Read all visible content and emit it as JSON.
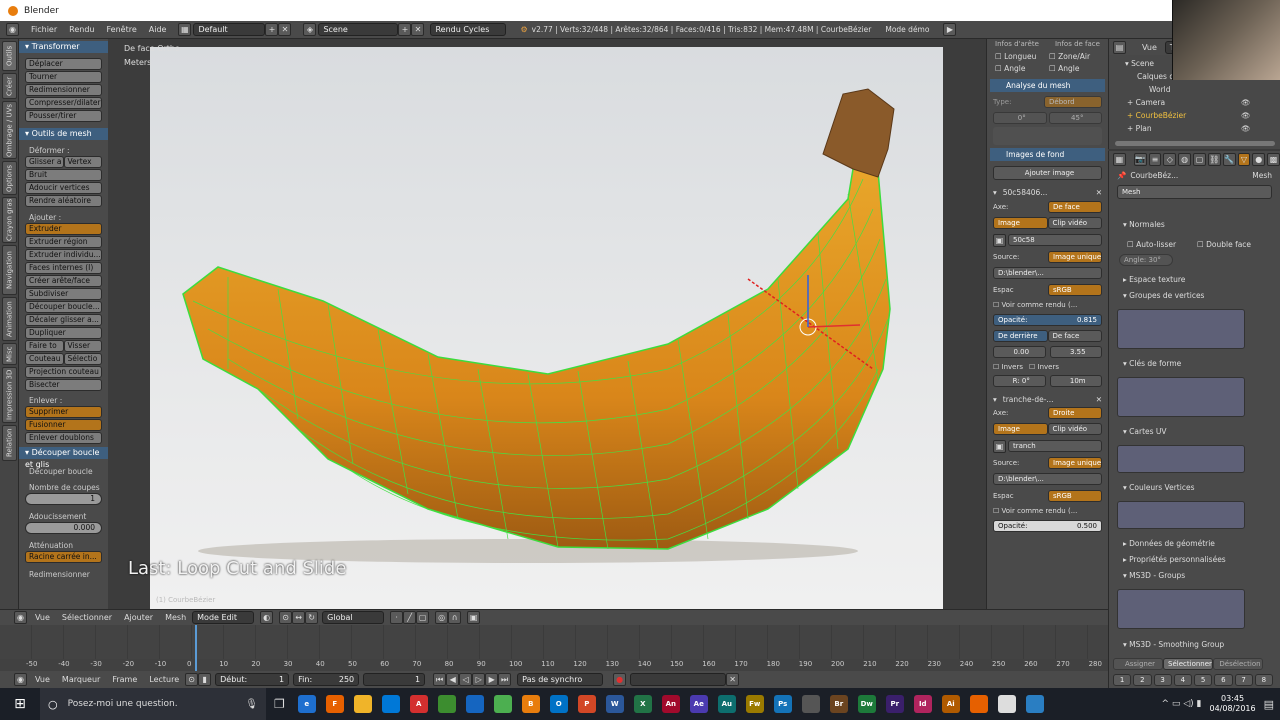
{
  "window": {
    "title": "Blender"
  },
  "menu": {
    "items": [
      "Fichier",
      "Rendu",
      "Fenêtre",
      "Aide"
    ],
    "layout": "Default",
    "scene": "Scene",
    "engine": "Rendu Cycles",
    "stats": "v2.77 | Verts:32/448 | Arêtes:32/864 | Faces:0/416 | Tris:832 | Mem:47.48M | CourbeBézier",
    "mode_label": "Mode démo"
  },
  "sidetabs": [
    "Outils",
    "Créer",
    "Ombrage / UVs",
    "Options",
    "Crayon gras",
    "Navigation",
    "Animation",
    "Misc",
    "Impression 3D",
    "Relation"
  ],
  "tools": {
    "transform_header": "Transformer",
    "transform_buttons": [
      "Déplacer",
      "Tourner",
      "Redimensionner",
      "Compresser/dilater",
      "Pousser/tirer"
    ],
    "mesh_header": "Outils de mesh",
    "deform_label": "Déformer :",
    "slide_left": "Glisser a",
    "slide_right": "Vertex",
    "deform_buttons": [
      "Bruit",
      "Adoucir vertices",
      "Rendre aléatoire"
    ],
    "add_label": "Ajouter :",
    "extrude": "Extruder",
    "add_buttons": [
      "Extruder région",
      "Extruder individu...",
      "Faces internes (I)",
      "Créer arête/face",
      "Subdiviser",
      "Découper boucle...",
      "Décaler glisser a...",
      "Dupliquer"
    ],
    "pair1": [
      "Faire to",
      "Visser"
    ],
    "pair2": [
      "Couteau",
      "Sélectio"
    ],
    "more_buttons": [
      "Projection couteau",
      "Bisecter"
    ],
    "remove_label": "Enlever :",
    "delete": "Supprimer",
    "merge": "Fusionner",
    "remove_doubles": "Enlever doublons",
    "op_header": "Découper boucle et glis",
    "op_title": "Découper boucle",
    "cuts_label": "Nombre de coupes",
    "cuts_value": "1",
    "smooth_label": "Adoucissement",
    "smooth_value": "0.000",
    "falloff_label": "Atténuation",
    "falloff_value": "Racine carrée in...",
    "resize_label": "Redimensionner"
  },
  "viewport": {
    "view_name": "De face Ortho",
    "units": "Meters",
    "last_op": "Last: Loop Cut and Slide",
    "object_label": "(1) CourbeBézier"
  },
  "vp_header": {
    "items": [
      "Vue",
      "Sélectionner",
      "Ajouter",
      "Mesh"
    ],
    "mode": "Mode Edit",
    "orientation": "Global"
  },
  "props": {
    "top_labels": [
      "Infos d'arête",
      "Infos de face"
    ],
    "checks": [
      "Longueu",
      "Zone/Air",
      "Angle",
      "Angle"
    ],
    "analysis_header": "Analyse du mesh",
    "type_label": "Type:",
    "type_value": "Débord",
    "angle_min": "0°",
    "angle_max": "45°",
    "bg_header": "Images de fond",
    "add_image": "Ajouter image",
    "img1_name": "50c58406...",
    "axis_label": "Axe:",
    "img1_axis": "De face",
    "image_btn": "Image",
    "clip_btn": "Clip vidéo",
    "img1_file": "50c58",
    "source_label": "Source:",
    "source_value": "Image unique",
    "path1": "D:\\blender\\...",
    "space_label": "Espac",
    "space_value": "sRGB",
    "view_as_render": "Voir comme rendu (...",
    "opacity_label": "Opacité:",
    "opacity1": "0.815",
    "behind": "De derrière",
    "front": "De face",
    "x1": "0.00",
    "y1": "3.55",
    "invert": "Invers",
    "rot": "R: 0°",
    "size": "10m",
    "img2_name": "tranche-de-...",
    "img2_axis": "Droite",
    "img2_file": "tranch",
    "path2": "D:\\blender\\...",
    "opacity2": "0.500"
  },
  "outliner": {
    "view": "Vue",
    "search_label": "Tou",
    "items": [
      "Scene",
      "Calques de rendu",
      "World",
      "Camera",
      "CourbeBézier",
      "Plan"
    ]
  },
  "propedit": {
    "breadcrumb_obj": "CourbeBéz...",
    "breadcrumb_mesh": "Mesh",
    "mesh_name": "Mesh",
    "normals": "Normales",
    "autosmooth": "Auto-lisser",
    "double_face": "Double face",
    "angle": "Angle: 30°",
    "sections": [
      "Espace texture",
      "Groupes de vertices",
      "Clés de forme",
      "Cartes UV",
      "Couleurs Vertices",
      "Données de géométrie",
      "Propriétés personnalisées",
      "MS3D - Groups",
      "MS3D - Smoothing Group"
    ],
    "bottom_buttons": [
      "Assigner",
      "Sélectionner",
      "Désélection"
    ],
    "numbers": [
      "1",
      "2",
      "3",
      "4",
      "5",
      "6",
      "7",
      "8"
    ]
  },
  "timeline": {
    "ticks": [
      "-50",
      "-40",
      "-30",
      "-20",
      "-10",
      "0",
      "10",
      "20",
      "30",
      "40",
      "50",
      "60",
      "70",
      "80",
      "90",
      "100",
      "110",
      "120",
      "130",
      "140",
      "150",
      "160",
      "170",
      "180",
      "190",
      "200",
      "210",
      "220",
      "230",
      "240",
      "250",
      "260",
      "270",
      "280"
    ],
    "menu": [
      "Vue",
      "Marqueur",
      "Frame",
      "Lecture"
    ],
    "start_label": "Début:",
    "start": "1",
    "end_label": "Fin:",
    "end": "250",
    "current": "1",
    "sync": "Pas de synchro"
  },
  "taskbar": {
    "search": "Posez-moi une question.",
    "time": "03:45",
    "date": "04/08/2016",
    "apps": [
      {
        "label": "e",
        "color": "#1e6fcf"
      },
      {
        "label": "F",
        "color": "#e66000"
      },
      {
        "label": "",
        "color": "#f0b429"
      },
      {
        "label": "",
        "color": "#0078d7"
      },
      {
        "label": "A",
        "color": "#d32f2f"
      },
      {
        "label": "",
        "color": "#3c8d2f"
      },
      {
        "label": "",
        "color": "#1565c0"
      },
      {
        "label": "",
        "color": "#4caf50"
      },
      {
        "label": "B",
        "color": "#e87d0d"
      },
      {
        "label": "O",
        "color": "#0072c6"
      },
      {
        "label": "P",
        "color": "#d24726"
      },
      {
        "label": "W",
        "color": "#2b579a"
      },
      {
        "label": "X",
        "color": "#217346"
      },
      {
        "label": "An",
        "color": "#a10a2c"
      },
      {
        "label": "Ae",
        "color": "#4b3ab0"
      },
      {
        "label": "Au",
        "color": "#0d6e6e"
      },
      {
        "label": "Fw",
        "color": "#9a7a00"
      },
      {
        "label": "Ps",
        "color": "#1473b8"
      },
      {
        "label": "",
        "color": "#555"
      },
      {
        "label": "Br",
        "color": "#6b4420"
      },
      {
        "label": "Dw",
        "color": "#1d7a3a"
      },
      {
        "label": "Pr",
        "color": "#3a1f6b"
      },
      {
        "label": "Id",
        "color": "#b0245e"
      },
      {
        "label": "Ai",
        "color": "#b05a00"
      },
      {
        "label": "",
        "color": "#e66000"
      },
      {
        "label": "",
        "color": "#ddd"
      },
      {
        "label": "",
        "color": "#2a7ec2"
      }
    ]
  }
}
